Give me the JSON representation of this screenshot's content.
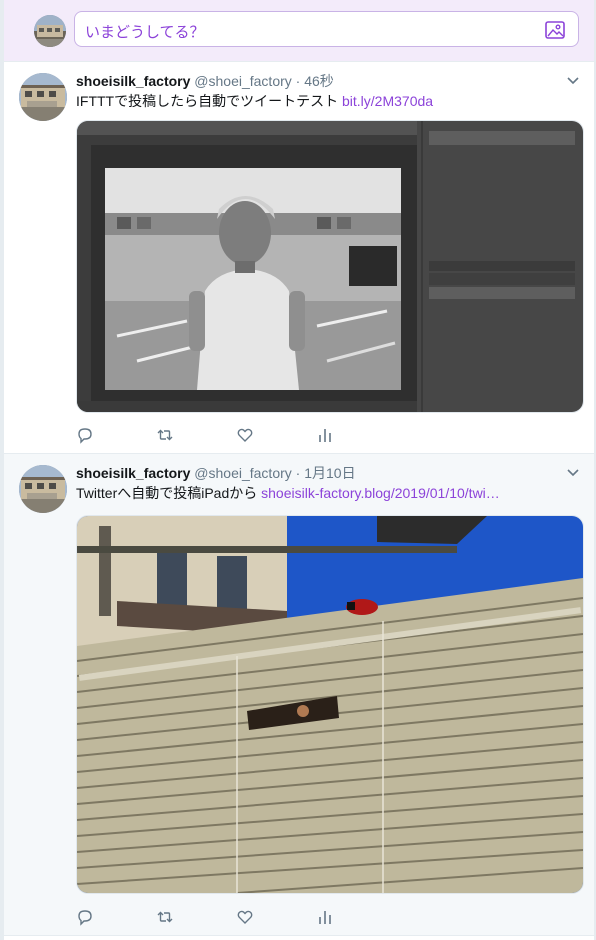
{
  "composer": {
    "placeholder": "いまどうしてる？",
    "media_icon": "image-icon"
  },
  "tweets": [
    {
      "name": "shoeisilk_factory",
      "handle": "@shoei_factory",
      "separator": "·",
      "time": "46秒",
      "text": "IFTTTで投稿したら自動でツイートテスト ",
      "link": "bit.ly/2M370da",
      "media_description": "photoshop-screenshot",
      "actions": [
        "reply-icon",
        "retweet-icon",
        "like-icon",
        "analytics-icon"
      ]
    },
    {
      "name": "shoeisilk_factory",
      "handle": "@shoei_factory",
      "separator": "·",
      "time": "1月10日",
      "text": "Twitterへ自動で投稿iPadから ",
      "link": "shoeisilk-factory.blog/2019/01/10/twi…",
      "media_description": "window-blinds-photo",
      "actions": [
        "reply-icon",
        "retweet-icon",
        "like-icon",
        "analytics-icon"
      ]
    }
  ],
  "colors": {
    "accent": "#8c43d9",
    "composer_bg": "#f3ebfa",
    "icon_gray": "#657786"
  }
}
